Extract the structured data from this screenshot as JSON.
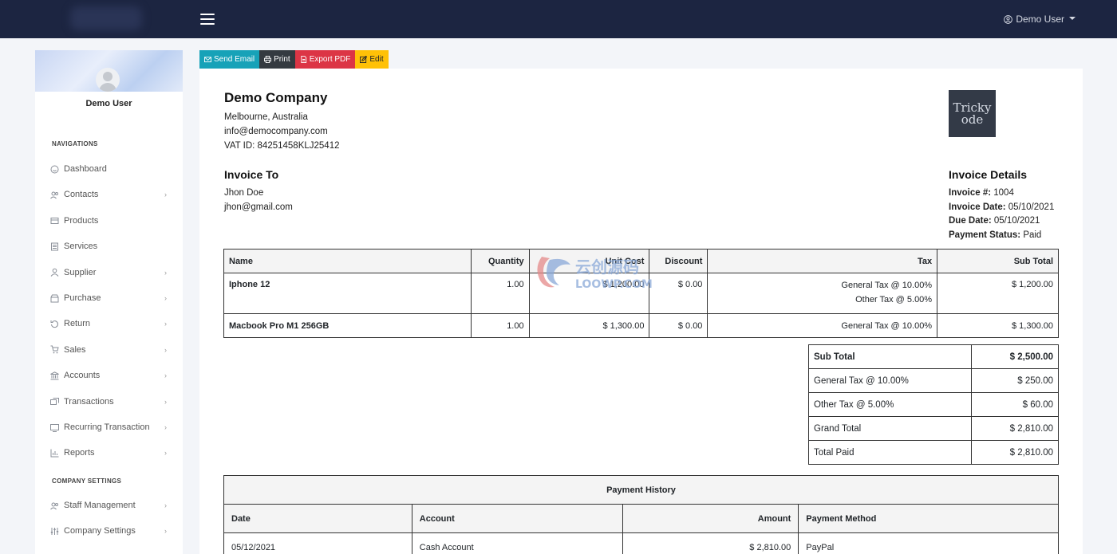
{
  "topbar": {
    "user_label": "Demo User"
  },
  "sidebar": {
    "user_name": "Demo User",
    "nav_heading": "NAVIGATIONS",
    "items": [
      {
        "label": "Dashboard",
        "icon": "dashboard-icon",
        "has_children": false
      },
      {
        "label": "Contacts",
        "icon": "contacts-icon",
        "has_children": true
      },
      {
        "label": "Products",
        "icon": "products-icon",
        "has_children": false
      },
      {
        "label": "Services",
        "icon": "services-icon",
        "has_children": false
      },
      {
        "label": "Supplier",
        "icon": "supplier-icon",
        "has_children": true
      },
      {
        "label": "Purchase",
        "icon": "purchase-icon",
        "has_children": true
      },
      {
        "label": "Return",
        "icon": "return-icon",
        "has_children": true
      },
      {
        "label": "Sales",
        "icon": "sales-icon",
        "has_children": true
      },
      {
        "label": "Accounts",
        "icon": "accounts-icon",
        "has_children": true
      },
      {
        "label": "Transactions",
        "icon": "transactions-icon",
        "has_children": true
      },
      {
        "label": "Recurring Transaction",
        "icon": "recurring-icon",
        "has_children": true
      },
      {
        "label": "Reports",
        "icon": "reports-icon",
        "has_children": true
      }
    ],
    "company_heading": "COMPANY SETTINGS",
    "company_items": [
      {
        "label": "Staff Management",
        "icon": "staff-icon",
        "has_children": true
      },
      {
        "label": "Company Settings",
        "icon": "settings-icon",
        "has_children": true
      }
    ]
  },
  "toolbar": {
    "send_email": "Send Email",
    "print": "Print",
    "export_pdf": "Export PDF",
    "edit": "Edit"
  },
  "company": {
    "name": "Demo Company",
    "address": "Melbourne, Australia",
    "email": "info@democompany.com",
    "vat": "VAT ID: 84251458KLJ25412",
    "logo_text_1": "Tricky",
    "logo_text_2": "ode"
  },
  "invoice_to": {
    "heading": "Invoice To",
    "name": "Jhon Doe",
    "email": "jhon@gmail.com"
  },
  "invoice_details": {
    "heading": "Invoice Details",
    "number_label": "Invoice #:",
    "number": "1004",
    "date_label": "Invoice Date:",
    "date": "05/10/2021",
    "due_label": "Due Date:",
    "due": "05/10/2021",
    "status_label": "Payment Status:",
    "status": "Paid"
  },
  "items_table": {
    "headers": [
      "Name",
      "Quantity",
      "Unit Cost",
      "Discount",
      "Tax",
      "Sub Total"
    ],
    "rows": [
      {
        "name": "Iphone 12",
        "qty": "1.00",
        "unit": "$ 1,200.00",
        "discount": "$ 0.00",
        "tax1": "General Tax @ 10.00%",
        "tax2": "Other Tax @ 5.00%",
        "subtotal": "$ 1,200.00"
      },
      {
        "name": "Macbook Pro M1 256GB",
        "qty": "1.00",
        "unit": "$ 1,300.00",
        "discount": "$ 0.00",
        "tax1": "General Tax @ 10.00%",
        "tax2": "",
        "subtotal": "$ 1,300.00"
      }
    ]
  },
  "totals": [
    {
      "label": "Sub Total",
      "value": "$ 2,500.00",
      "bold": true
    },
    {
      "label": "General Tax @ 10.00%",
      "value": "$ 250.00",
      "bold": false
    },
    {
      "label": "Other Tax @ 5.00%",
      "value": "$ 60.00",
      "bold": false
    },
    {
      "label": "Grand Total",
      "value": "$ 2,810.00",
      "bold": false
    },
    {
      "label": "Total Paid",
      "value": "$ 2,810.00",
      "bold": false
    }
  ],
  "payments": {
    "title": "Payment History",
    "headers": [
      "Date",
      "Account",
      "Amount",
      "Payment Method"
    ],
    "rows": [
      {
        "date": "05/12/2021",
        "account": "Cash Account",
        "amount": "$ 2,810.00",
        "method": "PayPal"
      }
    ]
  },
  "watermark": {
    "line1": "云创源码",
    "line2": "LOOWP.COM"
  }
}
